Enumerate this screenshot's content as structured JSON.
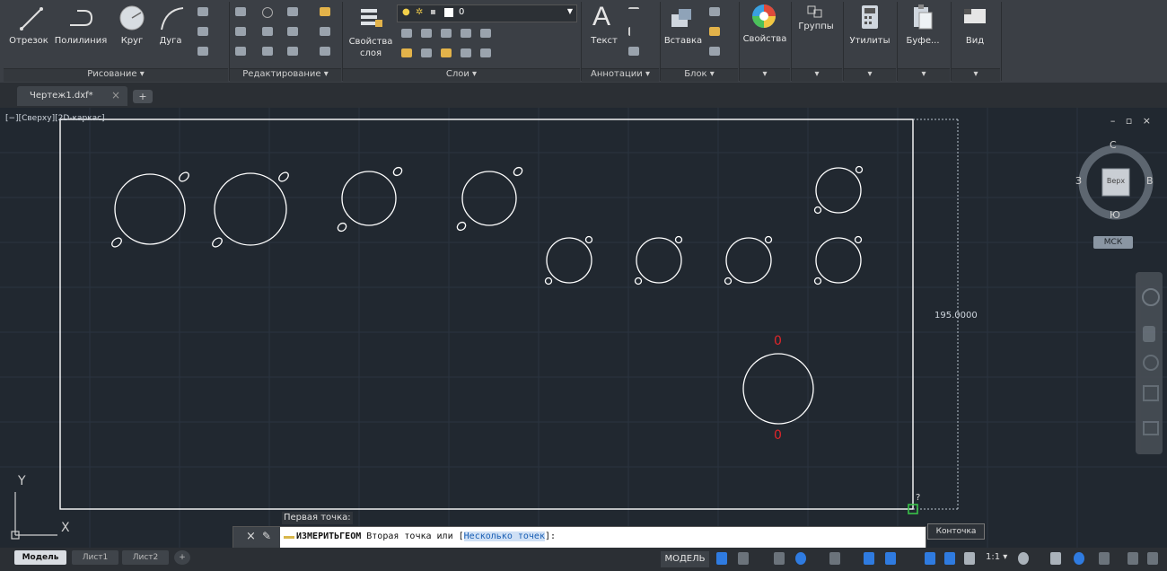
{
  "ribbon": {
    "draw_panel": {
      "label": "Рисование ▾",
      "tools": [
        "Отрезок",
        "Полилиния",
        "Круг",
        "Дуга"
      ]
    },
    "modify_panel": {
      "label": "Редактирование ▾"
    },
    "layers_panel": {
      "label": "Слои ▾",
      "layer_props_label": "Свойства слоя",
      "current_layer": "0"
    },
    "annotation_panel": {
      "label": "Аннотации ▾",
      "text_label": "Текст"
    },
    "block_panel": {
      "label": "Блок ▾",
      "insert_label": "Вставка"
    },
    "properties_label": "Свойства",
    "groups_label": "Группы",
    "utilities_label": "Утилиты",
    "clipboard_label": "Буфе...",
    "view_label": "Вид",
    "collapsed_arrow": "▾"
  },
  "tabs": {
    "document_tab": "Чертеж1.dxf*",
    "close_symbol": "×",
    "new_tab_symbol": "+"
  },
  "viewport": {
    "view_label": "[−][Сверху][2D-каркас]",
    "window_controls": "– ▫ ×",
    "viewcube": {
      "north": "С",
      "south": "Ю",
      "west": "З",
      "east": "В",
      "face": "Верх",
      "ucs_button": "МСК"
    },
    "dimension_text": "195.0000",
    "cursor_question": "?",
    "red_marker_top": "0",
    "red_marker_bottom": "0",
    "ucs_axis_x": "X",
    "ucs_axis_y": "Y",
    "snap_tooltip": "Конточка"
  },
  "command": {
    "prompt_label": "Первая точка:",
    "command_name": "ИЗМЕРИТЬГЕОМ",
    "command_text": " Вторая точка или ",
    "option_text": "Несколько точек",
    "open_bracket": "[",
    "close_bracket": "]:"
  },
  "layout_tabs": [
    "Модель",
    "Лист1",
    "Лист2"
  ],
  "layout_add": "+",
  "status": {
    "model_label": "МОДЕЛЬ",
    "scale_label": "1:1 ▾"
  },
  "colors": {
    "background": "#212830",
    "ribbon": "#3b3f45",
    "drawing_lines": "#ffffff",
    "red_marker": "#e0262a",
    "snap_marker": "#39c449",
    "accent_blue": "#2f7be0"
  },
  "icons": [
    "line-icon",
    "polyline-icon",
    "circle-icon",
    "arc-icon",
    "layer-properties-icon",
    "text-icon",
    "insert-icon",
    "color-wheel-icon",
    "groups-icon",
    "calculator-icon",
    "clipboard-icon",
    "view-icon",
    "viewcube-icon",
    "ucs-icon",
    "close-icon",
    "wrench-icon"
  ]
}
